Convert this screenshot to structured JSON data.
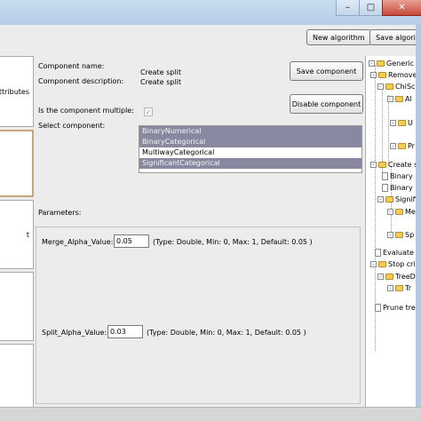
{
  "toolbar": {
    "new_algorithm": "New algorithm",
    "save_algorithm": "Save algorithm"
  },
  "left_panel": {
    "item_attributes": "ttributes",
    "item_t": "t"
  },
  "form": {
    "component_name_label": "Component name:",
    "component_name_value": "Create split",
    "component_description_label": "Component description:",
    "component_description_value": "Create split",
    "is_multiple_label": "Is the component multiple:",
    "is_multiple_checked": true,
    "select_component_label": "Select component:",
    "options": [
      {
        "label": "BinaryNumerical",
        "selected": true
      },
      {
        "label": "BinaryCategorical",
        "selected": true
      },
      {
        "label": "MultiwayCategorical",
        "selected": false
      },
      {
        "label": "SignificantCategorical",
        "selected": true
      }
    ],
    "save_component": "Save component",
    "disable_component": "Disable component",
    "parameters_label": "Parameters:"
  },
  "parameters": [
    {
      "name": "Merge_Alpha_Value:",
      "value": "0.05",
      "info": "(Type: Double, Min: 0, Max: 1, Default: 0.05 )"
    },
    {
      "name": "Split_Alpha_Value:",
      "value": "0.03",
      "info": "(Type: Double, Min: 0, Max: 1, Default: 0.05 )"
    }
  ],
  "tree": [
    "Generic Deci",
    "Remove i",
    "ChiSc",
    "Al",
    "U",
    "Pr",
    "Create sp",
    "Binary",
    "Binary",
    "Signific",
    "Me",
    "Sp",
    "Evaluate",
    "Stop crite",
    "TreeD",
    "Tr",
    "Prune tre"
  ],
  "colors": {
    "selection": "#8889a1",
    "selected_panel_border": "#c8a57a",
    "folder": "#f3cc56"
  }
}
